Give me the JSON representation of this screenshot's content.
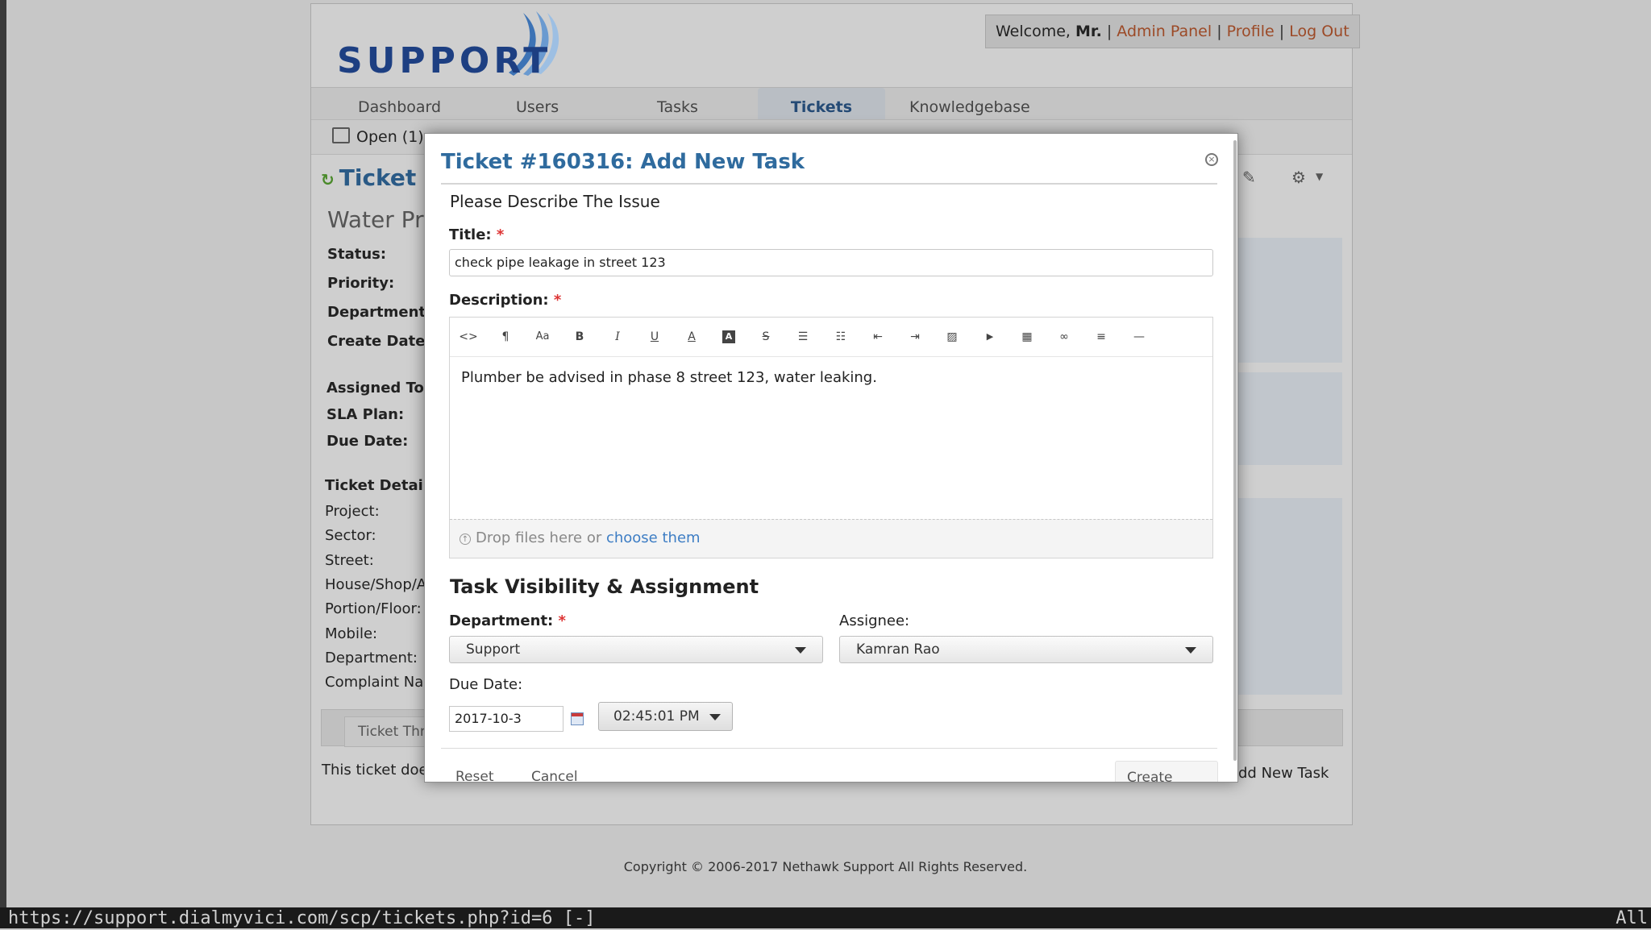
{
  "app": {
    "logo_text": "SUPPORT",
    "welcome_prefix": "Welcome, ",
    "welcome_name": "Mr.",
    "welcome_sep": " |",
    "links": [
      "Admin Panel",
      "Profile",
      "Log Out"
    ]
  },
  "nav": {
    "tabs": [
      "Dashboard",
      "Users",
      "Tasks",
      "Tickets",
      "Knowledgebase"
    ],
    "active": "Tickets"
  },
  "subnav": {
    "open_label": "Open (1)"
  },
  "background": {
    "ticket_title": "Ticket #",
    "subject": "Water Pro",
    "left_fields": [
      "Status:",
      "Priority:",
      "Department:",
      "Create Date:"
    ],
    "assign_fields": [
      "Assigned To",
      "SLA Plan:",
      "Due Date:"
    ],
    "details_heading": "Ticket Details",
    "detail_fields": [
      "Project:",
      "Sector:",
      "Street:",
      "House/Shop/A",
      "Portion/Floor:",
      "Mobile:",
      "Department:",
      "Complaint Na"
    ],
    "thread_tab": "Ticket Thr",
    "ticket_note": "This ticket doe",
    "add_new_task": "dd New Task"
  },
  "modal": {
    "title": "Ticket #160316: Add New Task",
    "intro": "Please Describe The Issue",
    "title_label": "Title:",
    "title_value": "check pipe leakage in street 123",
    "description_label": "Description:",
    "description_value": "Plumber be advised in phase 8 street 123, water leaking.",
    "required_mark": "*",
    "toolbar_icons": [
      "code-view-icon",
      "paragraph-icon",
      "font-size-icon",
      "bold-icon",
      "italic-icon",
      "underline-icon",
      "font-color-icon",
      "background-color-icon",
      "strikethrough-icon",
      "unordered-list-icon",
      "ordered-list-icon",
      "outdent-icon",
      "indent-icon",
      "image-icon",
      "video-icon",
      "table-icon",
      "link-icon",
      "align-icon",
      "horizontal-rule-icon"
    ],
    "toolbar_glyphs": [
      "<>",
      "¶",
      "Aa",
      "B",
      "I",
      "U",
      "A",
      "A",
      "S",
      "☰",
      "☷",
      "⇤",
      "⇥",
      "▨",
      "▶",
      "▦",
      "∞",
      "≡",
      "—"
    ],
    "drop_text": "Drop files here or ",
    "drop_link": "choose them",
    "section_title": "Task Visibility & Assignment",
    "department_label": "Department:",
    "department_value": "Support",
    "assignee_label": "Assignee:",
    "assignee_value": "Kamran Rao",
    "due_date_label": "Due Date:",
    "due_date_value": "2017-10-3",
    "due_time_value": "02:45:01 PM",
    "reset_label": "Reset",
    "cancel_label": "Cancel",
    "create_label": "Create Task"
  },
  "footer": {
    "copyright": "Copyright © 2006-2017 Nethawk Support All Rights Reserved."
  },
  "status_bar": {
    "url": "https://support.dialmyvici.com/scp/tickets.php?id=6 [-]",
    "mode": "All"
  },
  "colors": {
    "link": "#9c4a27",
    "title_blue": "#2f6b9e",
    "required": "#dd3333",
    "choose_link": "#3d7dc4"
  }
}
